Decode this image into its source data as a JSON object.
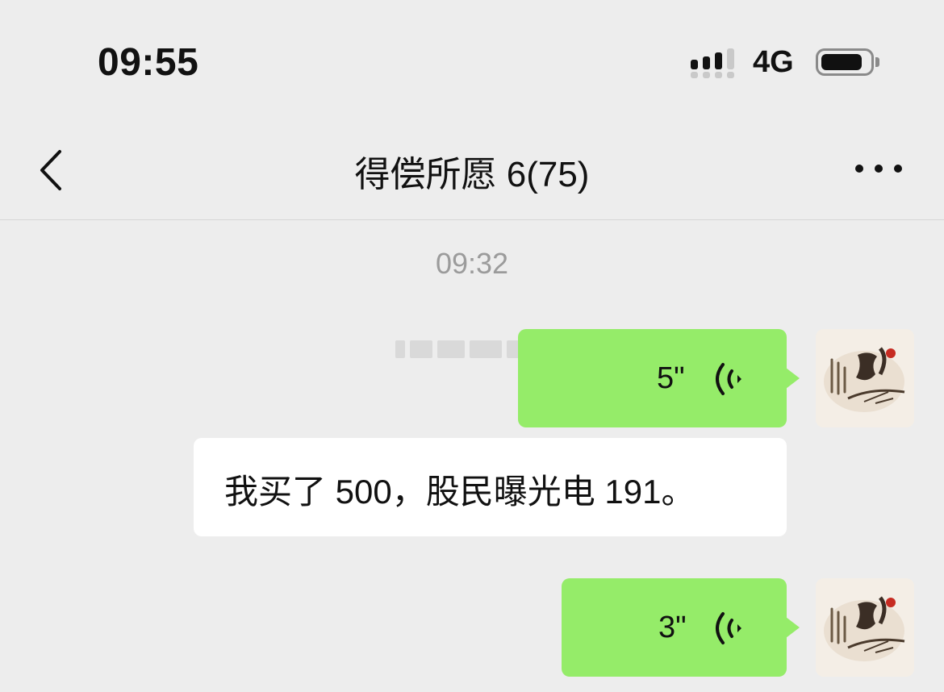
{
  "status_bar": {
    "time": "09:55",
    "network": "4G"
  },
  "nav": {
    "title": "得偿所愿 6(75)",
    "back_icon": "chevron-left-icon",
    "more_icon": "more-dots-icon"
  },
  "chat": {
    "timestamp": "09:32",
    "messages": [
      {
        "type": "voice",
        "duration": "5\"",
        "icon": "voice-wave-icon"
      },
      {
        "type": "text",
        "text": "我买了 500，股民曝光电 191。"
      },
      {
        "type": "voice",
        "duration": "3\"",
        "icon": "voice-wave-icon"
      }
    ]
  },
  "colors": {
    "background": "#ededed",
    "bubble_green": "#95ec69",
    "bubble_white": "#ffffff",
    "timestamp": "#9b9b9b"
  }
}
